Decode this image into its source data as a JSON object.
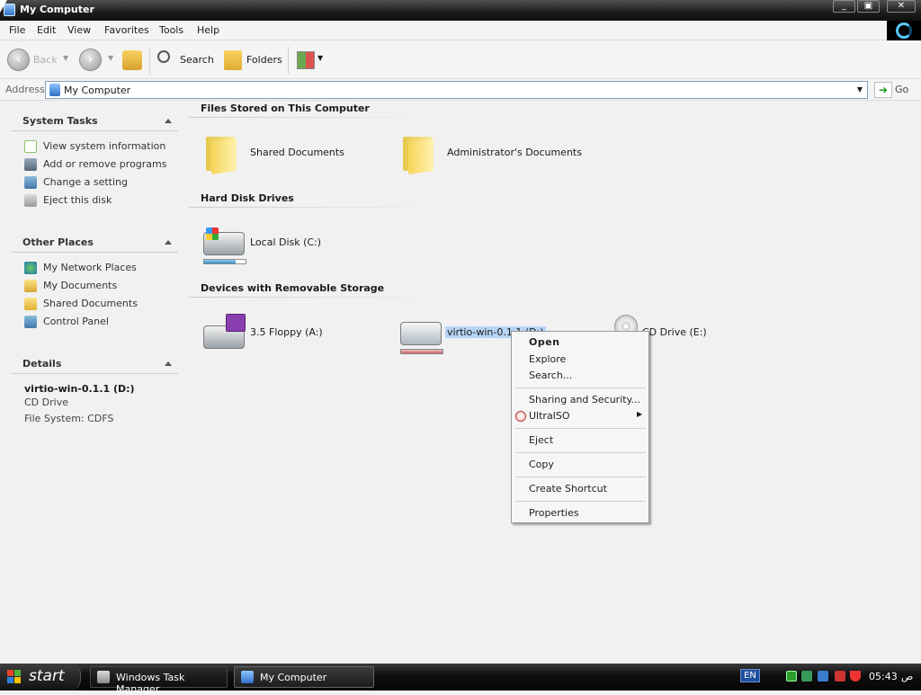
{
  "window": {
    "title": "My Computer"
  },
  "menu": [
    "File",
    "Edit",
    "View",
    "Favorites",
    "Tools",
    "Help"
  ],
  "toolbar": {
    "back": "Back",
    "search": "Search",
    "folders": "Folders"
  },
  "address": {
    "label": "Address",
    "value": "My Computer",
    "go": "Go"
  },
  "sidebar": {
    "system_tasks": {
      "title": "System Tasks",
      "items": [
        "View system information",
        "Add or remove programs",
        "Change a setting",
        "Eject this disk"
      ]
    },
    "other_places": {
      "title": "Other Places",
      "items": [
        "My Network Places",
        "My Documents",
        "Shared Documents",
        "Control Panel"
      ]
    },
    "details": {
      "title": "Details",
      "name": "virtio-win-0.1.1 (D:)",
      "type": "CD Drive",
      "filesystem": "File System: CDFS"
    }
  },
  "content": {
    "files_stored": {
      "title": "Files Stored on This Computer",
      "items": [
        "Shared Documents",
        "Administrator's Documents"
      ]
    },
    "hard_disks": {
      "title": "Hard Disk Drives",
      "items": [
        {
          "label": "Local Disk (C:)",
          "used_fraction": 0.75
        }
      ]
    },
    "removable": {
      "title": "Devices with Removable Storage",
      "items": [
        {
          "label": "3.5 Floppy (A:)"
        },
        {
          "label": "virtio-win-0.1.1 (D:)",
          "used_fraction": 1.0
        },
        {
          "label": "CD Drive (E:)"
        }
      ]
    }
  },
  "context_menu": {
    "items": [
      "Open",
      "Explore",
      "Search...",
      "Sharing and Security...",
      "UltraISO",
      "Eject",
      "Copy",
      "Create Shortcut",
      "Properties"
    ]
  },
  "taskbar": {
    "start": "start",
    "buttons": [
      "Windows Task Manager",
      "My Computer"
    ],
    "language": "EN",
    "clock": "05:43",
    "clock_suffix": "ص"
  },
  "colors": {
    "selection": "#b6d4f4",
    "capacity_c": "#4aa8d8",
    "capacity_d": "#d89090"
  }
}
